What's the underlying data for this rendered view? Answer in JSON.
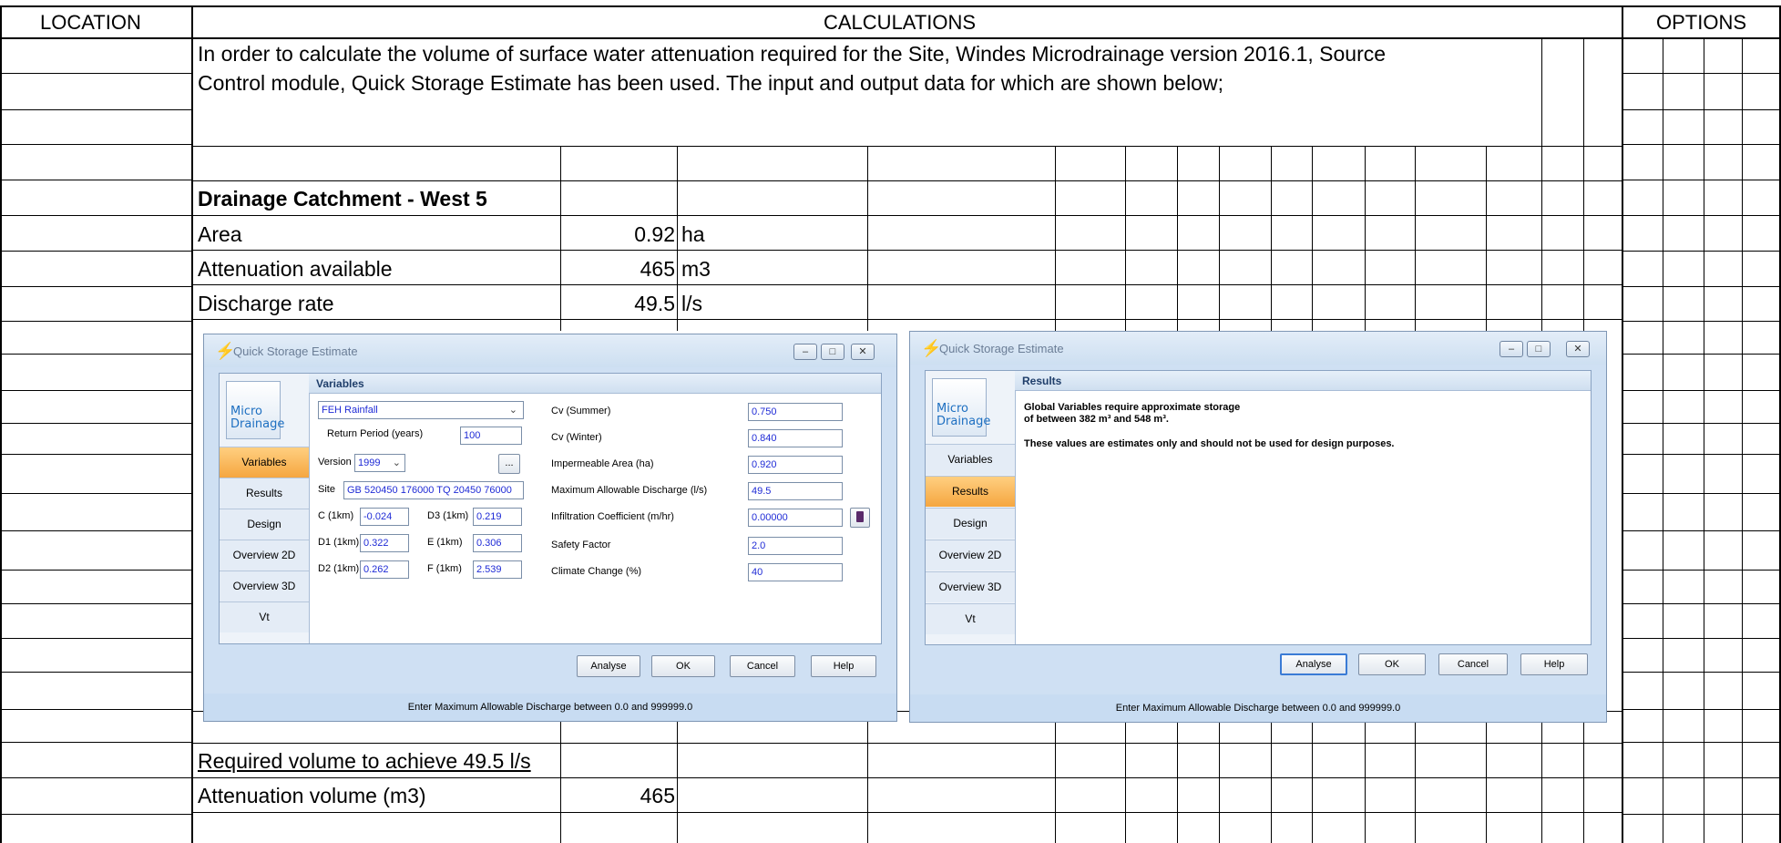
{
  "header": {
    "location": "LOCATION",
    "calculations": "CALCULATIONS",
    "options": "OPTIONS"
  },
  "intro": {
    "line1": "In order to calculate the volume of surface water attenuation required for the Site, Windes Microdrainage version 2016.1, Source",
    "line2": "Control module, Quick Storage Estimate has been used. The input and output data for which are shown below;"
  },
  "catchment": {
    "title": "Drainage Catchment - West 5",
    "rows": [
      {
        "label": "Area",
        "value": "0.92",
        "unit": "ha"
      },
      {
        "label": "Attenuation available",
        "value": "465",
        "unit": "m3"
      },
      {
        "label": "Discharge rate",
        "value": "49.5",
        "unit": "l/s"
      }
    ]
  },
  "result": {
    "heading": "Required volume to achieve 49.5 l/s",
    "label": "Attenuation volume (m3)",
    "value": "465"
  },
  "dialog_common": {
    "title": "Quick Storage Estimate",
    "logo": "Micro Drainage",
    "minimize": "–",
    "maximize": "□",
    "close": "✕",
    "nav": [
      "Variables",
      "Results",
      "Design",
      "Overview 2D",
      "Overview 3D",
      "Vt"
    ],
    "buttons": {
      "analyse": "Analyse",
      "ok": "OK",
      "cancel": "Cancel",
      "help": "Help"
    },
    "status": "Enter Maximum Allowable Discharge between 0.0 and 999999.0"
  },
  "variables_dialog": {
    "section": "Variables",
    "rainfall": "FEH Rainfall",
    "return_period_label": "Return Period (years)",
    "return_period": "100",
    "version_label": "Version",
    "version": "1999",
    "browse": "...",
    "site_label": "Site",
    "site": "GB 520450 176000 TQ 20450 76000",
    "c_label": "C (1km)",
    "c": "-0.024",
    "d1_label": "D1 (1km)",
    "d1": "0.322",
    "d2_label": "D2 (1km)",
    "d2": "0.262",
    "d3_label": "D3 (1km)",
    "d3": "0.219",
    "e_label": "E (1km)",
    "e": "0.306",
    "f_label": "F (1km)",
    "f": "2.539",
    "params": [
      {
        "label": "Cv (Summer)",
        "value": "0.750"
      },
      {
        "label": "Cv (Winter)",
        "value": "0.840"
      },
      {
        "label": "Impermeable Area (ha)",
        "value": "0.920"
      },
      {
        "label": "Maximum Allowable Discharge (l/s)",
        "value": "49.5"
      },
      {
        "label": "Infiltration Coefficient (m/hr)",
        "value": "0.00000"
      },
      {
        "label": "Safety Factor",
        "value": "2.0"
      },
      {
        "label": "Climate Change (%)",
        "value": "40"
      }
    ]
  },
  "results_dialog": {
    "section": "Results",
    "msg1": "Global Variables require approximate storage",
    "msg2": "of between 382 m³ and 548 m³.",
    "msg3": "These values are estimates only and should not be used for design purposes."
  }
}
